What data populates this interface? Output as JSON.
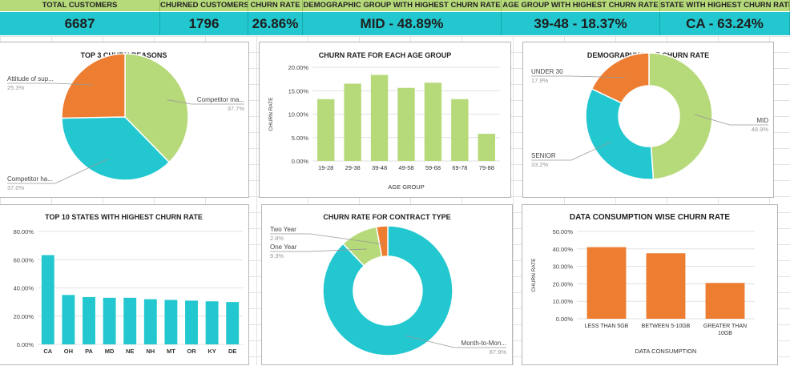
{
  "kpis": [
    {
      "label": "TOTAL CUSTOMERS",
      "value": "6687"
    },
    {
      "label": "CHURNED CUSTOMERS",
      "value": "1796"
    },
    {
      "label": "CHURN RATE",
      "value": "26.86%"
    },
    {
      "label": "DEMOGRAPHIC GROUP WITH HIGHEST CHURN RATE",
      "value": "MID - 48.89%"
    },
    {
      "label": "AGE GROUP WITH HIGHEST CHURN RATE",
      "value": "39-48 - 18.37%"
    },
    {
      "label": "STATE WITH HIGHEST CHURN RATE",
      "value": "CA - 63.24%"
    }
  ],
  "colors": {
    "green": "#b6d97a",
    "teal": "#22c7cf",
    "orange": "#ed7d31"
  },
  "chart_data": [
    {
      "id": "churn-reasons",
      "type": "pie",
      "title": "TOP 3 CHURN REASONS",
      "slices": [
        {
          "label": "Competitor ma...",
          "pct": "37.7%",
          "value": 37.7,
          "color": "#b6d97a"
        },
        {
          "label": "Competitor ha...",
          "pct": "37.0%",
          "value": 37.0,
          "color": "#22c7cf"
        },
        {
          "label": "Attitude of sup...",
          "pct": "25.3%",
          "value": 25.3,
          "color": "#ed7d31"
        }
      ]
    },
    {
      "id": "age-churn",
      "type": "bar",
      "title": "CHURN RATE FOR EACH AGE GROUP",
      "xlabel": "AGE GROUP",
      "ylabel": "CHURN RATE",
      "categories": [
        "19-28",
        "29-38",
        "39-48",
        "49-58",
        "59-68",
        "69-78",
        "79-88"
      ],
      "values": [
        13.2,
        16.5,
        18.37,
        15.6,
        16.7,
        13.2,
        5.8
      ],
      "yticks": [
        "0.00%",
        "5.00%",
        "10.00%",
        "15.00%",
        "20.00%"
      ],
      "ylim": [
        0,
        20
      ],
      "color": "#b6d97a"
    },
    {
      "id": "demography-churn",
      "type": "pie",
      "title": "DEMOGRAPHY WISE CHURN RATE",
      "slices": [
        {
          "label": "MID",
          "pct": "48.9%",
          "value": 48.9,
          "color": "#b6d97a"
        },
        {
          "label": "SENIOR",
          "pct": "33.2%",
          "value": 33.2,
          "color": "#22c7cf"
        },
        {
          "label": "UNDER 30",
          "pct": "17.9%",
          "value": 17.9,
          "color": "#ed7d31"
        }
      ]
    },
    {
      "id": "state-churn",
      "type": "bar",
      "title": "TOP 10 STATES WITH HIGHEST CHURN RATE",
      "categories": [
        "CA",
        "OH",
        "PA",
        "MD",
        "NE",
        "NH",
        "MT",
        "OR",
        "KY",
        "DE"
      ],
      "values": [
        63.24,
        35,
        33.5,
        33,
        33,
        32,
        31.5,
        31,
        30.5,
        30
      ],
      "yticks": [
        "0.00%",
        "20.00%",
        "40.00%",
        "60.00%",
        "80.00%"
      ],
      "ylim": [
        0,
        80
      ],
      "color": "#22c7cf"
    },
    {
      "id": "contract-churn",
      "type": "pie",
      "title": "CHURN RATE FOR CONTRACT TYPE",
      "slices": [
        {
          "label": "Month-to-Mon...",
          "pct": "87.9%",
          "value": 87.9,
          "color": "#22c7cf"
        },
        {
          "label": "One Year",
          "pct": "9.3%",
          "value": 9.3,
          "color": "#b6d97a"
        },
        {
          "label": "Two Year",
          "pct": "2.8%",
          "value": 2.8,
          "color": "#ed7d31"
        }
      ]
    },
    {
      "id": "data-churn",
      "type": "bar",
      "title": "DATA CONSUMPTION WISE CHURN RATE",
      "xlabel": "DATA CONSUMPTION",
      "ylabel": "CHURN RATE",
      "categories": [
        "LESS THAN 5GB",
        "BETWEEN 5-10GB",
        "GREATER THAN 10GB"
      ],
      "values": [
        41,
        37.5,
        20.5
      ],
      "yticks": [
        "0.00%",
        "10.00%",
        "20.00%",
        "30.00%",
        "40.00%",
        "50.00%"
      ],
      "ylim": [
        0,
        50
      ],
      "color": "#ed7d31"
    }
  ]
}
